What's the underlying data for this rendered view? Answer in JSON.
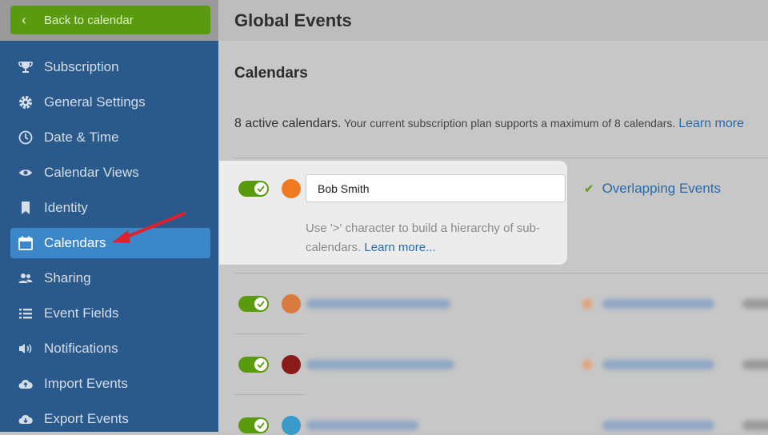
{
  "sidebar": {
    "back_label": "Back to calendar",
    "items": [
      {
        "label": "Subscription",
        "icon": "trophy-icon"
      },
      {
        "label": "General Settings",
        "icon": "gear-icon"
      },
      {
        "label": "Date & Time",
        "icon": "clock-icon"
      },
      {
        "label": "Calendar Views",
        "icon": "eye-icon"
      },
      {
        "label": "Identity",
        "icon": "bookmark-icon"
      },
      {
        "label": "Calendars",
        "icon": "calendar-icon",
        "active": true
      },
      {
        "label": "Sharing",
        "icon": "users-icon"
      },
      {
        "label": "Event Fields",
        "icon": "list-icon"
      },
      {
        "label": "Notifications",
        "icon": "speaker-icon"
      },
      {
        "label": "Import Events",
        "icon": "cloud-upload-icon"
      },
      {
        "label": "Export Events",
        "icon": "cloud-download-icon"
      }
    ]
  },
  "header": {
    "title": "Global Events"
  },
  "main": {
    "section_title": "Calendars",
    "active_count": "8 active calendars.",
    "plan_text": "Your current subscription plan supports a maximum of 8 calendars.",
    "learn_more": "Learn more"
  },
  "editor": {
    "name_value": "Bob Smith",
    "hint_text": "Use '>' character to build a hierarchy of sub-calendars.",
    "hint_link": "Learn more...",
    "overlap_label": "Overlapping Events",
    "color": "#f07a20"
  },
  "colors": {
    "accent_green": "#5a9a0e",
    "sidebar_blue": "#2a5a8c",
    "active_blue": "#3a87c9",
    "link_blue": "#2a6aa7",
    "arrow_red": "#e0202a",
    "row_colors": [
      "#d97a3e",
      "#8b1a1a",
      "#3a9ac9"
    ]
  }
}
